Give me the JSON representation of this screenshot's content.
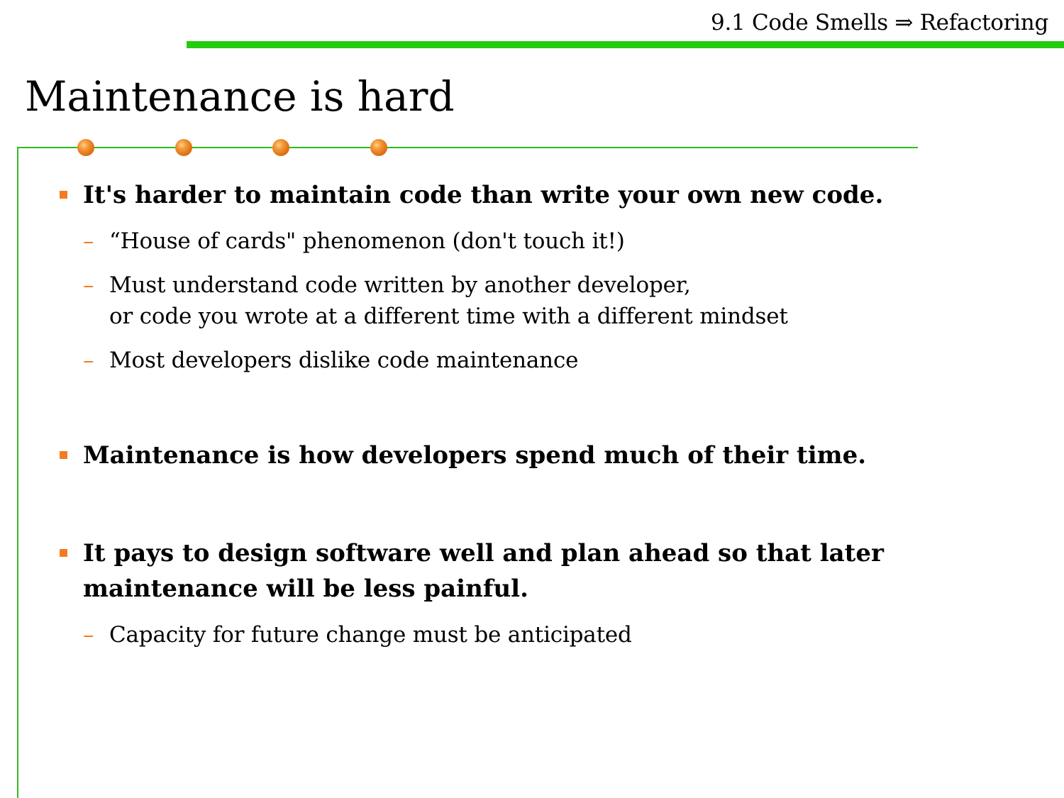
{
  "header": {
    "title": "9.1 Code Smells ⇒ Refactoring"
  },
  "slide": {
    "title": "Maintenance is hard"
  },
  "colors": {
    "accent_green": "#22cc11",
    "frame_green": "#33bb22",
    "bullet_orange": "#f47b20",
    "dot_orange": "#e37416"
  },
  "bullets": [
    {
      "text": "It's harder to maintain code than write your own new code.",
      "subs": [
        {
          "lines": [
            "“House of cards\" phenomenon (don't touch it!)"
          ]
        },
        {
          "lines": [
            "Must understand code written by another developer,",
            "or code you wrote at a different time with a different mindset"
          ]
        },
        {
          "lines": [
            "Most developers dislike code maintenance"
          ]
        }
      ]
    },
    {
      "text": "Maintenance is how developers spend much of their time.",
      "subs": []
    },
    {
      "lines": [
        "It pays to design software well and plan ahead so that later",
        "maintenance will be less painful."
      ],
      "subs": [
        {
          "lines": [
            "Capacity for future change must be anticipated"
          ]
        }
      ]
    }
  ]
}
